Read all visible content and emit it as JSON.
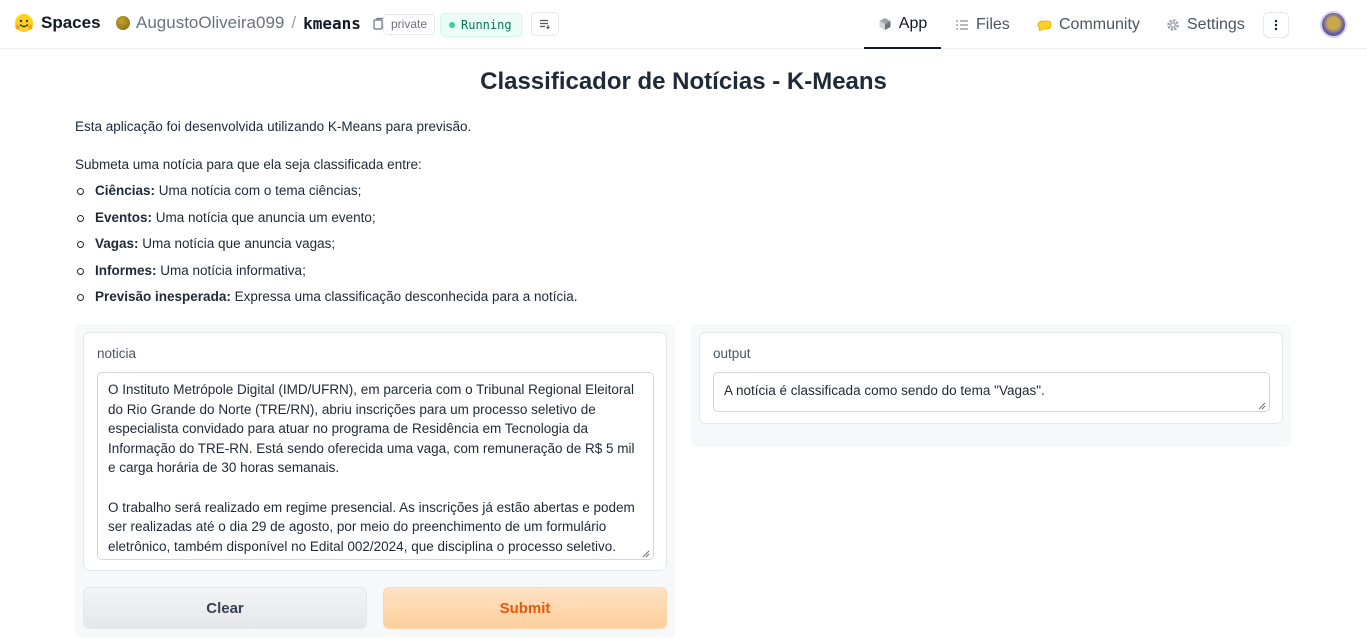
{
  "header": {
    "brand": "Spaces",
    "owner": "AugustoOliveira099",
    "separator": "/",
    "repo": "kmeans",
    "visibility": "private",
    "status": "Running",
    "nav": [
      {
        "label": "App",
        "icon": "cube-icon",
        "active": true
      },
      {
        "label": "Files",
        "icon": "files-icon",
        "active": false
      },
      {
        "label": "Community",
        "icon": "community-icon",
        "active": false
      },
      {
        "label": "Settings",
        "icon": "gear-icon",
        "active": false
      }
    ]
  },
  "main": {
    "title": "Classificador de Notícias - K-Means",
    "description": "Esta aplicação foi desenvolvida utilizando K-Means para previsão.",
    "intro": "Submeta uma notícia para que ela seja classificada entre:",
    "categories": [
      {
        "name": "Ciências:",
        "text": " Uma notícia com o tema ciências;"
      },
      {
        "name": "Eventos:",
        "text": " Uma notícia que anuncia um evento;"
      },
      {
        "name": "Vagas:",
        "text": " Uma notícia que anuncia vagas;"
      },
      {
        "name": "Informes:",
        "text": " Uma notícia informativa;"
      },
      {
        "name": "Previsão inesperada:",
        "text": " Expressa uma classificação desconhecida para a notícia."
      }
    ],
    "input": {
      "label": "noticia",
      "value": "O Instituto Metrópole Digital (IMD/UFRN), em parceria com o Tribunal Regional Eleitoral do Rio Grande do Norte (TRE/RN), abriu inscrições para um processo seletivo de especialista convidado para atuar no programa de Residência em Tecnologia da Informação do TRE-RN. Está sendo oferecida uma vaga, com remuneração de R$ 5 mil e carga horária de 30 horas semanais.\n\nO trabalho será realizado em regime presencial. As inscrições já estão abertas e podem ser realizadas até o dia 29 de agosto, por meio do preenchimento de um formulário eletrônico, também disponível no Edital 002/2024, que disciplina o processo seletivo."
    },
    "output": {
      "label": "output",
      "value": "A notícia é classificada como sendo do tema \"Vagas\"."
    },
    "buttons": {
      "clear": "Clear",
      "submit": "Submit"
    }
  },
  "colors": {
    "accent": "#ea580c",
    "running": "#34d399",
    "submit_bg": "#ffcf9c"
  }
}
